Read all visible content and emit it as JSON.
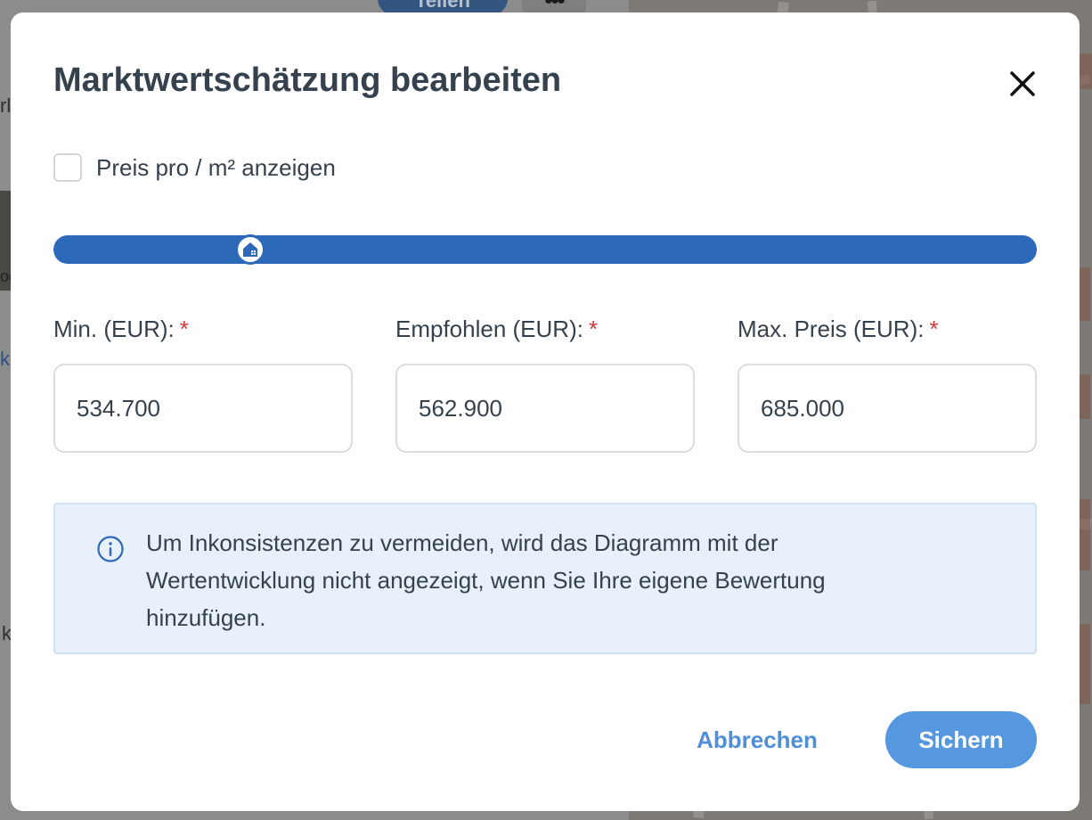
{
  "background": {
    "share_button_label": "Teilen",
    "more_button_label": "•••",
    "fragments": [
      "rl",
      "k",
      "k",
      "og"
    ]
  },
  "modal": {
    "title": "Marktwertschätzung bearbeiten",
    "close_icon": "close-icon",
    "checkbox": {
      "label": "Preis pro / m² anzeigen",
      "checked": false
    },
    "slider": {
      "thumb_icon": "house-icon",
      "position_fraction": 0.2,
      "color": "#2c69b9"
    },
    "fields": [
      {
        "label": "Min. (EUR):",
        "required_mark": "*",
        "value": "534.700"
      },
      {
        "label": "Empfohlen (EUR):",
        "required_mark": "*",
        "value": "562.900"
      },
      {
        "label": "Max. Preis (EUR):",
        "required_mark": "*",
        "value": "685.000"
      }
    ],
    "info": {
      "icon": "info-icon",
      "text": "Um Inkonsistenzen zu vermeiden, wird das Diagramm mit der Wertentwicklung nicht angezeigt, wenn Sie Ihre eigene Bewertung hinzufügen."
    },
    "buttons": {
      "cancel_label": "Abbrechen",
      "save_label": "Sichern"
    }
  },
  "colors": {
    "accent": "#2c69b9",
    "primary_button": "#5598e0",
    "required": "#d23a3a",
    "info_background": "#e8f0fa"
  }
}
